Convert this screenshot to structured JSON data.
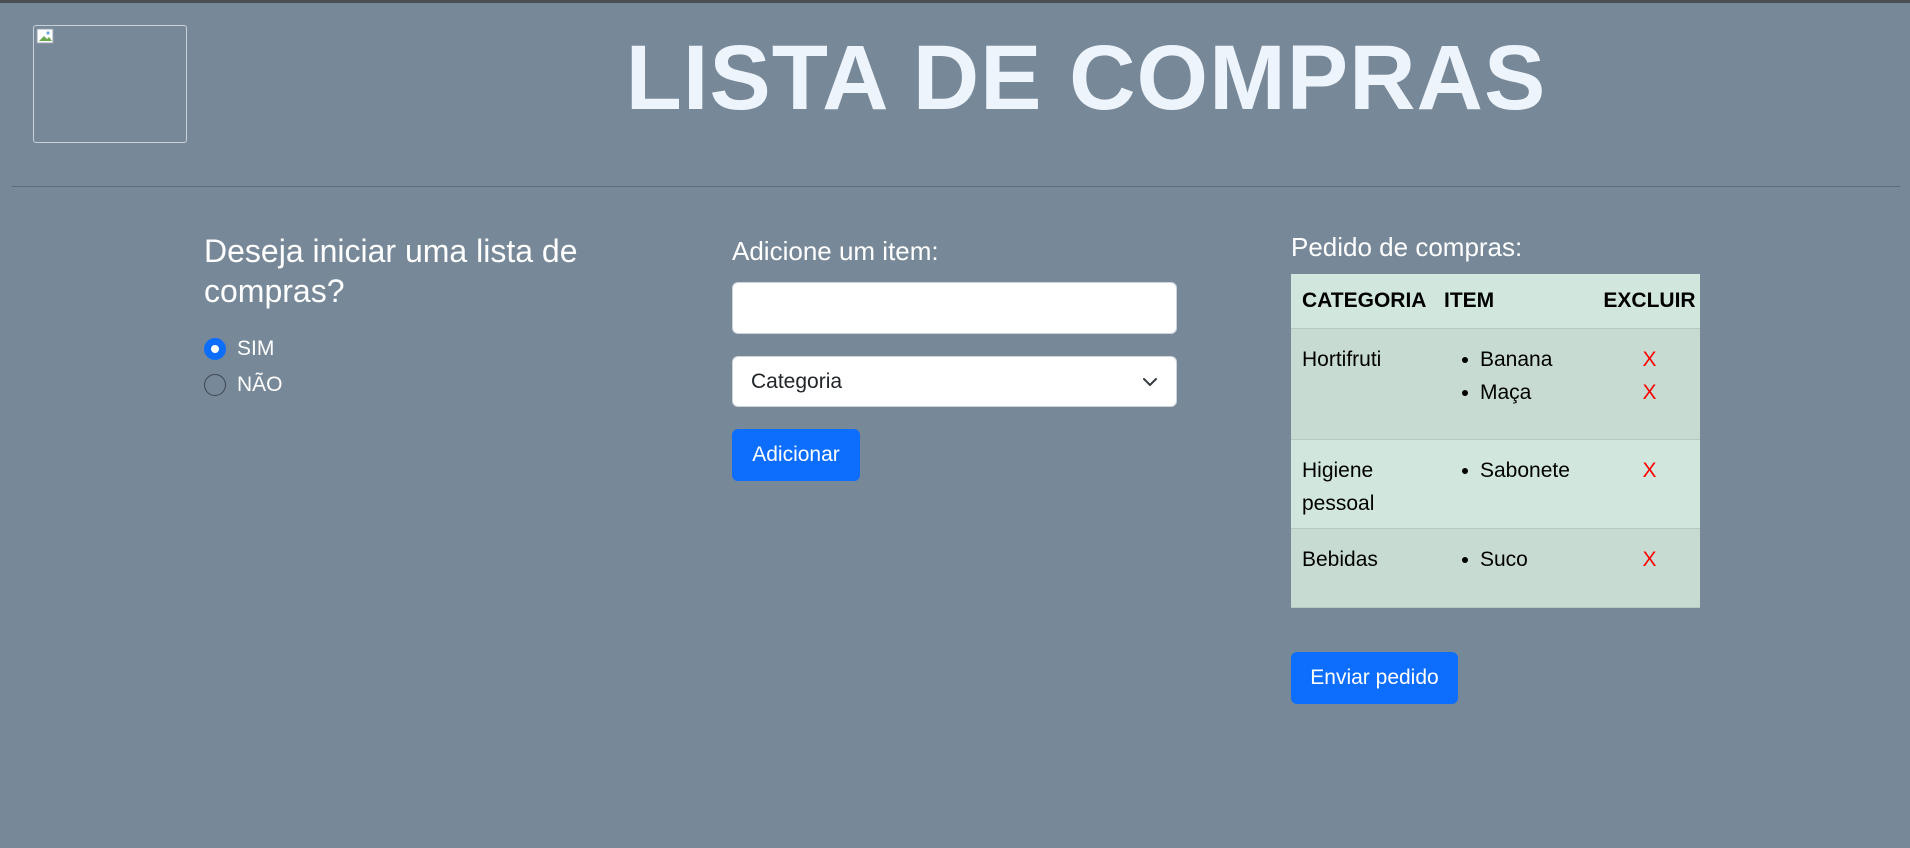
{
  "header": {
    "title": "LISTA DE COMPRAS",
    "logo": "broken-image-icon"
  },
  "start": {
    "question": "Deseja iniciar uma lista de compras?",
    "options": [
      {
        "label": "SIM",
        "checked": true
      },
      {
        "label": "NÃO",
        "checked": false
      }
    ]
  },
  "add": {
    "label": "Adicione um item:",
    "input_value": "",
    "category_selected": "Categoria",
    "button": "Adicionar"
  },
  "order": {
    "label": "Pedido de compras:",
    "headers": [
      "CATEGORIA",
      "ITEM",
      "EXCLUIR"
    ],
    "rows": [
      {
        "category": "Hortifruti",
        "items": [
          "Banana",
          "Maça"
        ],
        "delete": [
          "X",
          "X"
        ]
      },
      {
        "category": "Higiene pessoal",
        "items": [
          "Sabonete"
        ],
        "delete": [
          "X"
        ]
      },
      {
        "category": "Bebidas",
        "items": [
          "Suco"
        ],
        "delete": [
          "X"
        ]
      }
    ],
    "send_button": "Enviar pedido"
  },
  "colors": {
    "background": "#778899",
    "primary": "#0d6efd",
    "table_bg": "#d1e7dd",
    "delete": "#ff0000"
  }
}
